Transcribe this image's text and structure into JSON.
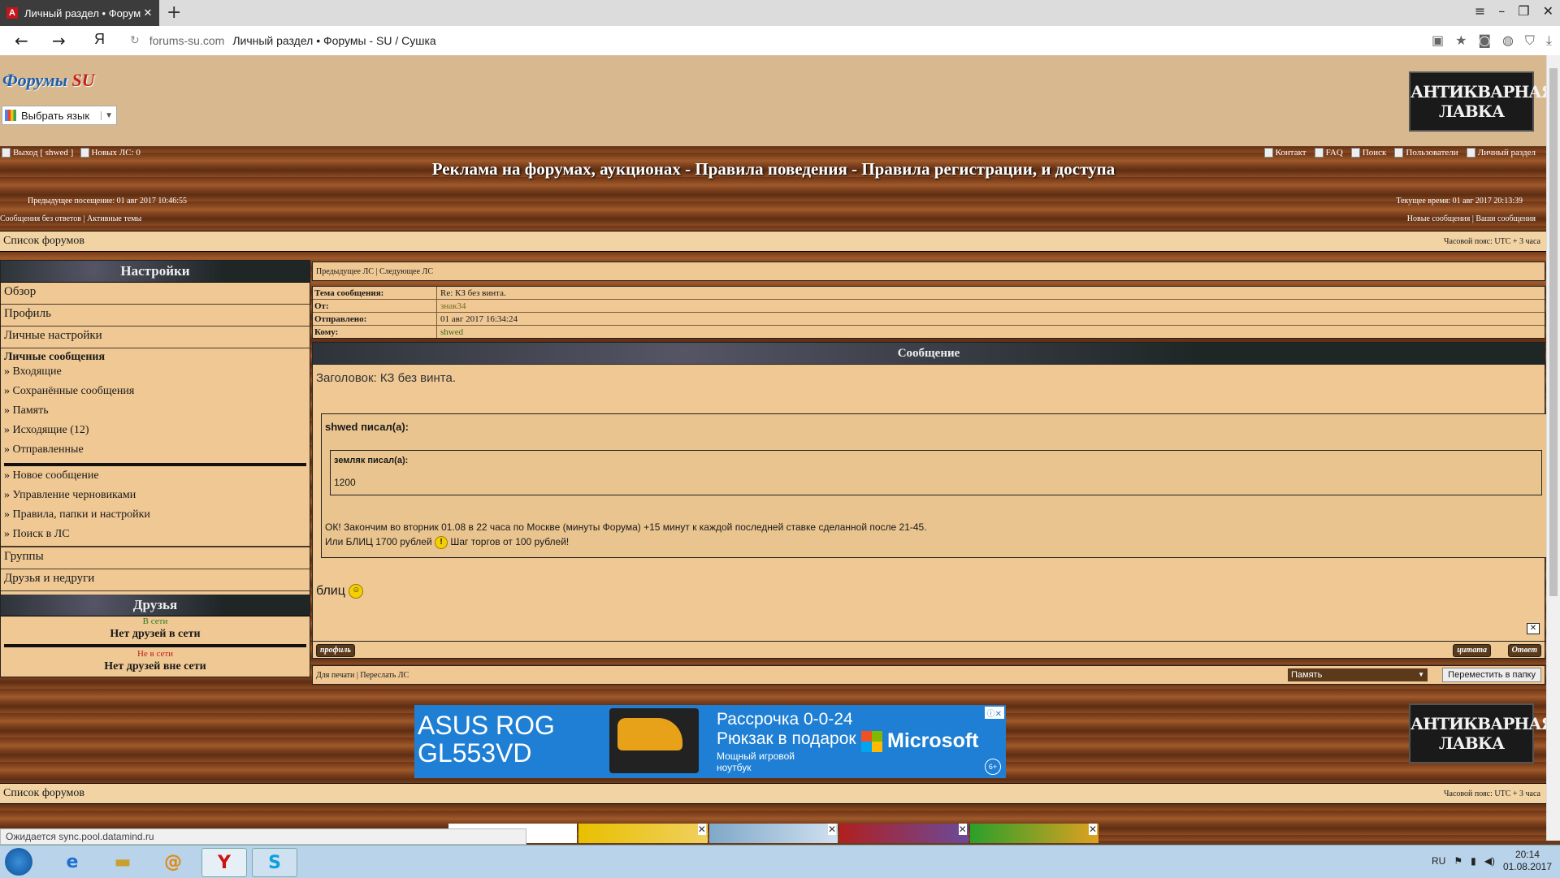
{
  "browser": {
    "tab_title": "Личный раздел • Форумы",
    "tab_icon": "yandex-browser-icon",
    "url_domain": "forums-su.com",
    "url_title": "Личный раздел • Форумы - SU / Сушка"
  },
  "header": {
    "logo_text": "Форумы",
    "logo_su": "SU",
    "language_select": "Выбрать язык",
    "banner_line1": "АНТИКВАРНАЯ",
    "banner_line2": "ЛАВКА",
    "site_title": "Реклама на форумах, аукционах - Правила поведения - Правила регистрации, и доступа",
    "user_links": [
      "Выход [ shwed ]",
      "Новых ЛС: 0"
    ],
    "top_links": [
      "Контакт",
      "FAQ",
      "Поиск",
      "Пользователи",
      "Личный раздел"
    ],
    "last_visit": "Предыдущее посещение: 01 авг 2017 10:46:55",
    "current_time": "Текущее время: 01 авг 2017 20:13:39",
    "left_links": "Сообщения без ответов | Активные темы",
    "right_links": "Новые сообщения | Ваши сообщения"
  },
  "breadcrumb": {
    "label": "Список форумов",
    "timezone": "Часовой пояс: UTC + 3 часа"
  },
  "sidebar": {
    "settings_title": "Настройки",
    "items": [
      "Обзор",
      "Профиль",
      "Личные настройки"
    ],
    "pm_title": "Личные сообщения",
    "pm_items": [
      "» Входящие",
      "» Сохранённые сообщения",
      "» Память",
      "» Исходящие (12)",
      "» Отправленные"
    ],
    "pm_actions": [
      "» Новое сообщение",
      "» Управление черновиками",
      "» Правила, папки и настройки",
      "» Поиск в ЛС"
    ],
    "groups": "Группы",
    "friends_foes": "Друзья и недруги",
    "friends_title": "Друзья",
    "online_label": "В сети",
    "online_text": "Нет друзей в сети",
    "offline_label": "Не в сети",
    "offline_text": "Нет друзей вне сети"
  },
  "message": {
    "nav": "Предыдущее ЛС | Следующее ЛС",
    "meta_labels": [
      "Тема сообщения:",
      "От:",
      "Отправлено:",
      "Кому:"
    ],
    "subject": "Re: КЗ без винта.",
    "from": "знак34",
    "sent": "01 авг 2017 16:34:24",
    "to": "shwed",
    "section_title": "Сообщение",
    "heading": "Заголовок: КЗ без винта.",
    "quote_outer_author": "shwed писал(а):",
    "quote_inner_author": "земляк писал(а):",
    "quote_inner_text": "1200",
    "line1": "ОК! Закончим во вторник 01.08 в 22 часа по Москве (минуты Форума) +15 минут к каждой последней ставке сделанной после 21-45.",
    "line2a": "Или БЛИЦ 1700 рублей",
    "line2b": "Шаг торгов от 100 рублей!",
    "reply_text": "блиц",
    "btn_profile": "профиль",
    "btn_quote": "цитата",
    "btn_reply": "Ответ",
    "footer_links": "Для печати | Переслать ЛС",
    "folder_selected": "Память",
    "move_button": "Переместить в папку"
  },
  "ad": {
    "brand": "ASUS ROG",
    "model": "GL553VD",
    "offer1": "Рассрочка 0-0-24",
    "offer2": "Рюкзак в подарок",
    "small1": "Мощный игровой",
    "small2": "ноутбук",
    "ms": "Microsoft",
    "age": "6+"
  },
  "status_text": "Ожидается sync.pool.datamind.ru",
  "taskbar": {
    "lang": "RU",
    "time": "20:14",
    "date": "01.08.2017"
  }
}
